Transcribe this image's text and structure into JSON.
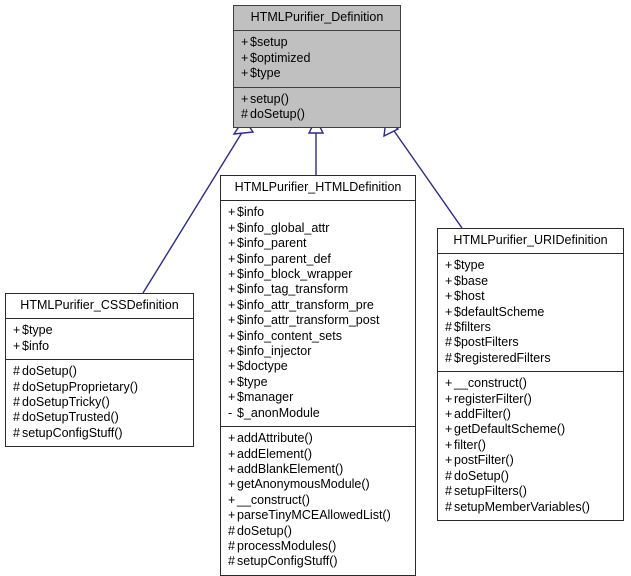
{
  "diagram": {
    "kind": "uml-class-inheritance-diagram",
    "edge_color": "#2a2a8c",
    "base_fill": "#c0c0c0",
    "border_color": "#2b2b2b",
    "classes": [
      {
        "id": "definition",
        "name": "HTMLPurifier_Definition",
        "highlighted": true,
        "attributes": [
          {
            "visibility": "+",
            "name": "$setup"
          },
          {
            "visibility": "+",
            "name": "$optimized"
          },
          {
            "visibility": "+",
            "name": "$type"
          }
        ],
        "methods": [
          {
            "visibility": "+",
            "name": "setup()"
          },
          {
            "visibility": "#",
            "name": "doSetup()"
          }
        ]
      },
      {
        "id": "cssdefinition",
        "name": "HTMLPurifier_CSSDefinition",
        "highlighted": false,
        "attributes": [
          {
            "visibility": "+",
            "name": "$type"
          },
          {
            "visibility": "+",
            "name": "$info"
          }
        ],
        "methods": [
          {
            "visibility": "#",
            "name": "doSetup()"
          },
          {
            "visibility": "#",
            "name": "doSetupProprietary()"
          },
          {
            "visibility": "#",
            "name": "doSetupTricky()"
          },
          {
            "visibility": "#",
            "name": "doSetupTrusted()"
          },
          {
            "visibility": "#",
            "name": "setupConfigStuff()"
          }
        ]
      },
      {
        "id": "htmldefinition",
        "name": "HTMLPurifier_HTMLDefinition",
        "highlighted": false,
        "attributes": [
          {
            "visibility": "+",
            "name": "$info"
          },
          {
            "visibility": "+",
            "name": "$info_global_attr"
          },
          {
            "visibility": "+",
            "name": "$info_parent"
          },
          {
            "visibility": "+",
            "name": "$info_parent_def"
          },
          {
            "visibility": "+",
            "name": "$info_block_wrapper"
          },
          {
            "visibility": "+",
            "name": "$info_tag_transform"
          },
          {
            "visibility": "+",
            "name": "$info_attr_transform_pre"
          },
          {
            "visibility": "+",
            "name": "$info_attr_transform_post"
          },
          {
            "visibility": "+",
            "name": "$info_content_sets"
          },
          {
            "visibility": "+",
            "name": "$info_injector"
          },
          {
            "visibility": "+",
            "name": "$doctype"
          },
          {
            "visibility": "+",
            "name": "$type"
          },
          {
            "visibility": "+",
            "name": "$manager"
          },
          {
            "visibility": "-",
            "name": "$_anonModule"
          }
        ],
        "methods": [
          {
            "visibility": "+",
            "name": "addAttribute()"
          },
          {
            "visibility": "+",
            "name": "addElement()"
          },
          {
            "visibility": "+",
            "name": "addBlankElement()"
          },
          {
            "visibility": "+",
            "name": "getAnonymousModule()"
          },
          {
            "visibility": "+",
            "name": "__construct()"
          },
          {
            "visibility": "+",
            "name": "parseTinyMCEAllowedList()"
          },
          {
            "visibility": "#",
            "name": "doSetup()"
          },
          {
            "visibility": "#",
            "name": "processModules()"
          },
          {
            "visibility": "#",
            "name": "setupConfigStuff()"
          }
        ]
      },
      {
        "id": "uridefinition",
        "name": "HTMLPurifier_URIDefinition",
        "highlighted": false,
        "attributes": [
          {
            "visibility": "+",
            "name": "$type"
          },
          {
            "visibility": "+",
            "name": "$base"
          },
          {
            "visibility": "+",
            "name": "$host"
          },
          {
            "visibility": "+",
            "name": "$defaultScheme"
          },
          {
            "visibility": "#",
            "name": "$filters"
          },
          {
            "visibility": "#",
            "name": "$postFilters"
          },
          {
            "visibility": "#",
            "name": "$registeredFilters"
          }
        ],
        "methods": [
          {
            "visibility": "+",
            "name": "__construct()"
          },
          {
            "visibility": "+",
            "name": "registerFilter()"
          },
          {
            "visibility": "+",
            "name": "addFilter()"
          },
          {
            "visibility": "+",
            "name": "getDefaultScheme()"
          },
          {
            "visibility": "+",
            "name": "filter()"
          },
          {
            "visibility": "+",
            "name": "postFilter()"
          },
          {
            "visibility": "#",
            "name": "doSetup()"
          },
          {
            "visibility": "#",
            "name": "setupFilters()"
          },
          {
            "visibility": "#",
            "name": "setupMemberVariables()"
          }
        ]
      }
    ],
    "relationships": [
      {
        "type": "generalization",
        "from": "cssdefinition",
        "to": "definition"
      },
      {
        "type": "generalization",
        "from": "htmldefinition",
        "to": "definition"
      },
      {
        "type": "generalization",
        "from": "uridefinition",
        "to": "definition"
      }
    ]
  }
}
